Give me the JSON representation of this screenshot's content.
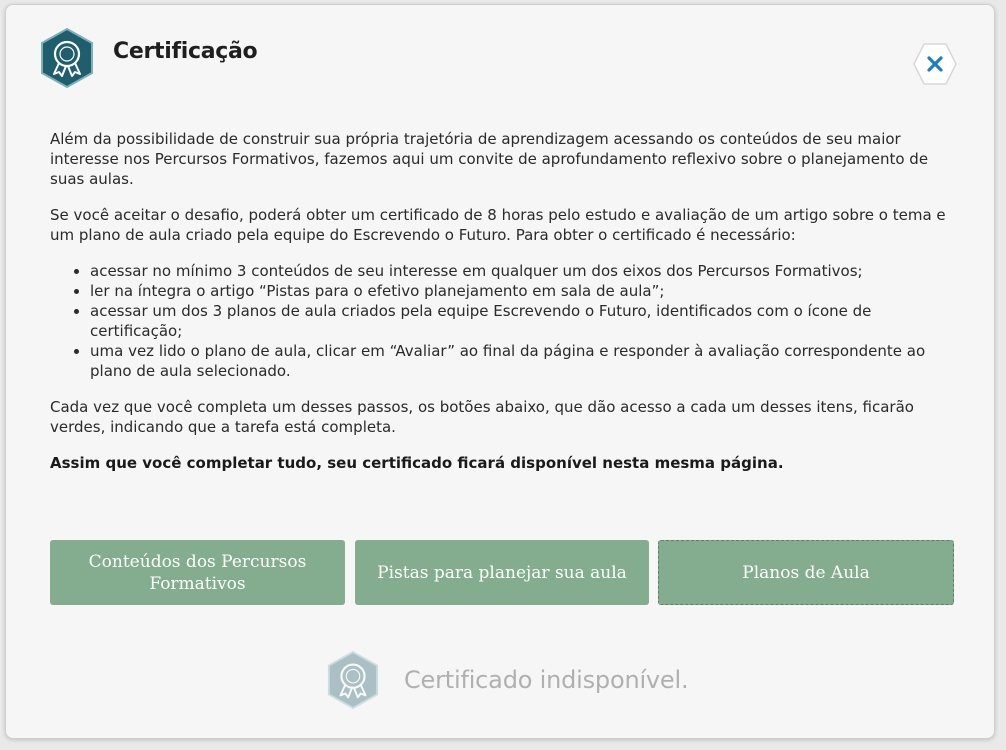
{
  "modal": {
    "title": "Certificação",
    "header_icon": "certificate-badge-icon",
    "close_icon": "close-icon",
    "colors": {
      "badge_teal": "#1f5e6c",
      "button_green": "#83ad8e",
      "close_x": "#1a7fc4",
      "disabled_text": "#b0b0b0"
    }
  },
  "content": {
    "paragraph1": "Além da possibilidade de construir sua própria trajetória de aprendizagem acessando os conteúdos de seu maior interesse nos Percursos Formativos, fazemos aqui um convite de aprofundamento reflexivo sobre o planejamento de suas aulas.",
    "paragraph2": "Se você aceitar o desafio, poderá obter um certificado de 8 horas pelo estudo e avaliação de um artigo sobre o tema e um plano de aula criado pela equipe do Escrevendo o Futuro. Para obter o certificado é necessário:",
    "steps": [
      "acessar no mínimo 3 conteúdos de seu interesse em qualquer um dos eixos dos Percursos Formativos;",
      "ler na íntegra o artigo “Pistas para o efetivo planejamento em sala de aula”;",
      "acessar um dos 3 planos de aula criados pela equipe Escrevendo o Futuro, identificados com o ícone de certificação;",
      "uma vez lido o plano de aula, clicar em “Avaliar” ao final da página e responder à avaliação correspondente ao plano de aula selecionado."
    ],
    "paragraph3": "Cada vez que você completa um desses passos, os botões abaixo, que dão acesso a cada um desses itens, ficarão verdes, indicando que a tarefa está completa.",
    "paragraph4": "Assim que você completar tudo, seu certificado ficará disponível nesta mesma página."
  },
  "buttons": [
    {
      "label": "Conteúdos dos Percursos Formativos"
    },
    {
      "label": "Pistas para planejar sua aula"
    },
    {
      "label": "Planos de Aula"
    }
  ],
  "certificate": {
    "status_text": "Certificado indisponível.",
    "icon": "certificate-badge-icon"
  }
}
